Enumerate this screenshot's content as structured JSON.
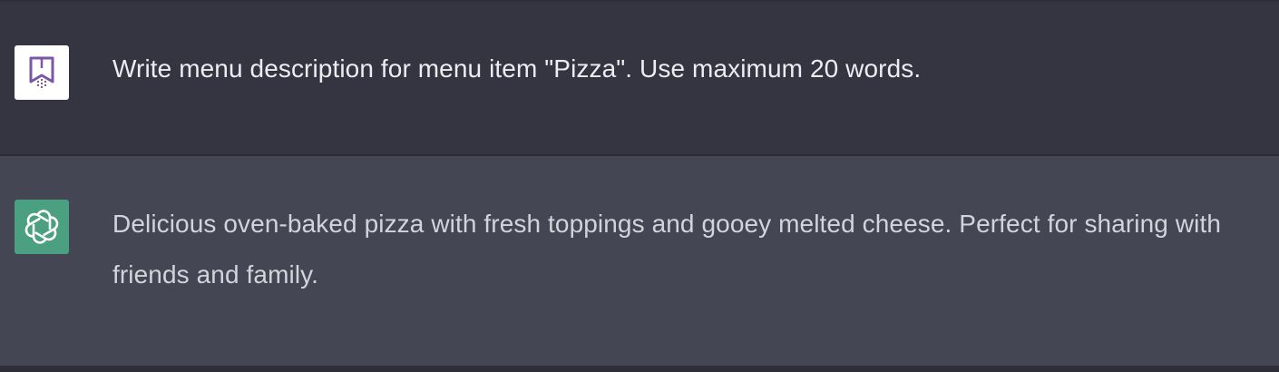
{
  "conversation": {
    "user_message": {
      "text": "Write menu description for menu item \"Pizza\". Use maximum 20 words.",
      "avatar_icon": "user-logo-icon"
    },
    "assistant_message": {
      "text": "Delicious oven-baked pizza with fresh toppings and gooey melted cheese. Perfect for sharing with friends and family.",
      "avatar_icon": "openai-logo-icon"
    }
  },
  "colors": {
    "user_row_bg": "#343541",
    "assistant_row_bg": "#444654",
    "assistant_avatar_bg": "#4aa081",
    "user_avatar_accent": "#7b57a8"
  }
}
